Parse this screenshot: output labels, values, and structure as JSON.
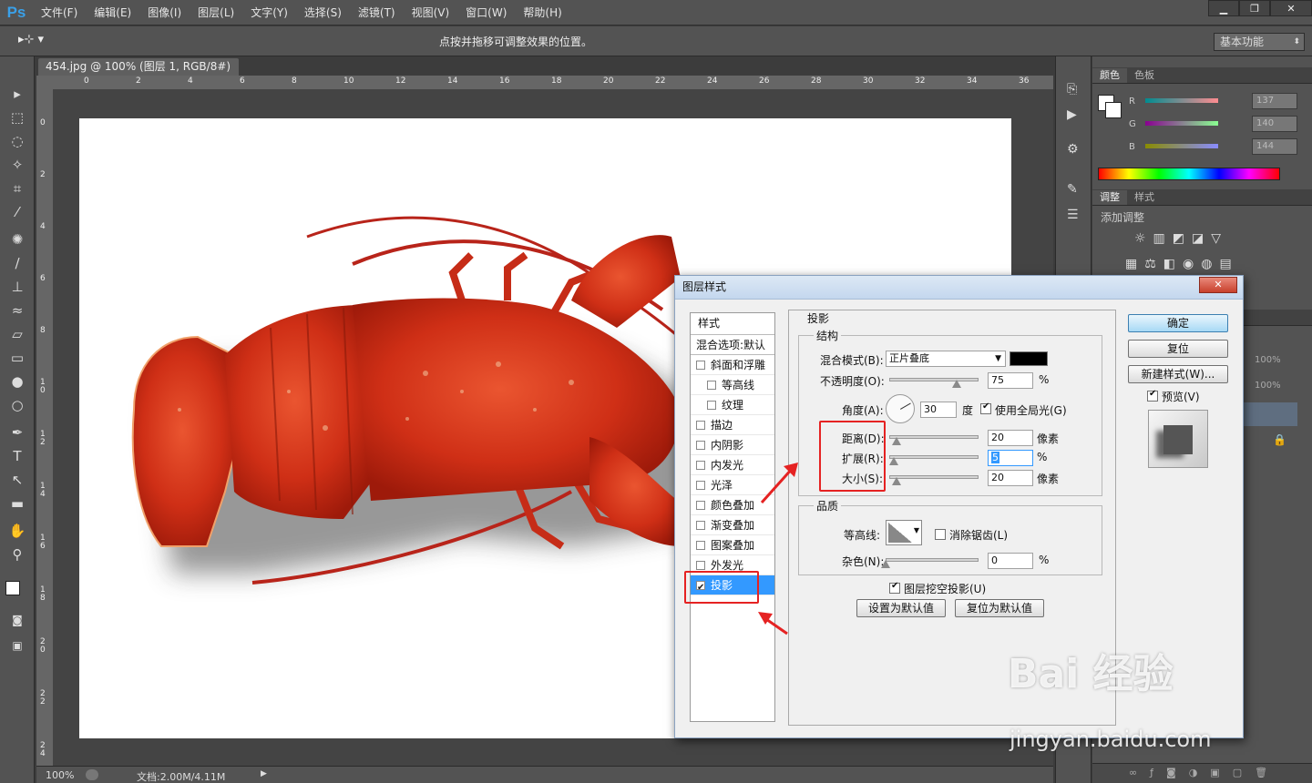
{
  "app": {
    "logo": "Ps",
    "menu": [
      "文件(F)",
      "编辑(E)",
      "图像(I)",
      "图层(L)",
      "文字(Y)",
      "选择(S)",
      "滤镜(T)",
      "视图(V)",
      "窗口(W)",
      "帮助(H)"
    ],
    "window_controls": [
      "▁",
      "❐",
      "✕"
    ]
  },
  "options_bar": {
    "tool": "▸⊹ ▾",
    "hint": "点按并拖移可调整效果的位置。",
    "workspace": "基本功能"
  },
  "document": {
    "tab_title": "454.jpg @ 100% (图层 1, RGB/8#) *",
    "tab_close": "×",
    "ruler_h": [
      "0",
      "2",
      "4",
      "6",
      "8",
      "10",
      "12",
      "14",
      "16",
      "18",
      "20",
      "22",
      "24",
      "26",
      "28",
      "30",
      "32",
      "34",
      "36"
    ],
    "ruler_v": [
      "0",
      "2",
      "4",
      "6",
      "8",
      "1\n0",
      "1\n2",
      "1\n4",
      "1\n6",
      "1\n8",
      "2\n0",
      "2\n2",
      "2\n4"
    ],
    "zoom": "100%",
    "doc_size": "文档:2.00M/4.11M"
  },
  "panels": {
    "color_tabs": [
      "颜色",
      "色板"
    ],
    "rgb": [
      {
        "label": "R",
        "value": "137"
      },
      {
        "label": "G",
        "value": "140"
      },
      {
        "label": "B",
        "value": "144"
      }
    ],
    "adjust_tabs": [
      "调整",
      "样式"
    ],
    "adjust_title": "添加调整",
    "layers_values": [
      "100%",
      "100%"
    ]
  },
  "dialog": {
    "title": "图层样式",
    "close": "✕",
    "styles_header": "样式",
    "blend_options": "混合选项:默认",
    "style_items": [
      {
        "label": "斜面和浮雕",
        "sub": false,
        "checked": false
      },
      {
        "label": "等高线",
        "sub": true,
        "checked": false
      },
      {
        "label": "纹理",
        "sub": true,
        "checked": false
      },
      {
        "label": "描边",
        "sub": false,
        "checked": false
      },
      {
        "label": "内阴影",
        "sub": false,
        "checked": false
      },
      {
        "label": "内发光",
        "sub": false,
        "checked": false
      },
      {
        "label": "光泽",
        "sub": false,
        "checked": false
      },
      {
        "label": "颜色叠加",
        "sub": false,
        "checked": false
      },
      {
        "label": "渐变叠加",
        "sub": false,
        "checked": false
      },
      {
        "label": "图案叠加",
        "sub": false,
        "checked": false
      },
      {
        "label": "外发光",
        "sub": false,
        "checked": false
      },
      {
        "label": "投影",
        "sub": false,
        "checked": true,
        "selected": true
      }
    ],
    "section_title": "投影",
    "structure_label": "结构",
    "blend_mode_label": "混合模式(B):",
    "blend_mode_value": "正片叠底",
    "opacity_label": "不透明度(O):",
    "opacity_value": "75",
    "opacity_unit": "%",
    "angle_label": "角度(A):",
    "angle_value": "30",
    "angle_unit": "度",
    "global_light": "使用全局光(G)",
    "distance_label": "距离(D):",
    "distance_value": "20",
    "distance_unit": "像素",
    "spread_label": "扩展(R):",
    "spread_value": "5",
    "spread_unit": "%",
    "size_label": "大小(S):",
    "size_value": "20",
    "size_unit": "像素",
    "quality_label": "品质",
    "contour_label": "等高线:",
    "antialias": "消除锯齿(L)",
    "noise_label": "杂色(N):",
    "noise_value": "0",
    "noise_unit": "%",
    "knockout": "图层挖空投影(U)",
    "make_default": "设置为默认值",
    "reset_default": "复位为默认值",
    "ok": "确定",
    "reset": "复位",
    "new_style": "新建样式(W)...",
    "preview": "预览(V)"
  },
  "watermark": {
    "brand": "Bai 经验",
    "url": "jingyan.baidu.com"
  },
  "colors": {
    "ps_bg": "#535353",
    "canvas_bg": "#444444",
    "highlight": "#3399ff",
    "annotation": "#e52222",
    "lobster": "#d9381e"
  }
}
